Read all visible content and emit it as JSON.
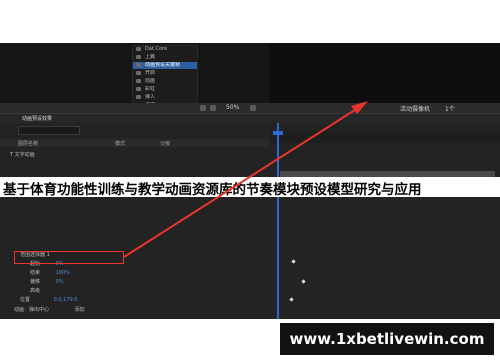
{
  "menu": {
    "items": [
      {
        "label": "Dat.Core"
      },
      {
        "label": "上翼"
      },
      {
        "label": "动画预设关键帧",
        "selected": true
      },
      {
        "label": "开启"
      },
      {
        "label": "动画"
      },
      {
        "label": "彩虹"
      },
      {
        "label": "弹入"
      },
      {
        "label": "弹跳"
      },
      {
        "label": "弹簧"
      }
    ]
  },
  "status": {
    "zoom": "50%",
    "view": "活动摄像机",
    "views": "1个"
  },
  "comp_tab": {
    "label": "动画预设效果"
  },
  "columns": {
    "layer_name": "图层名称",
    "parent": "父级",
    "mode": "模式"
  },
  "timeline_rows": [
    {
      "label": "T 文字动画"
    },
    {
      "label": "范围选择器 1"
    },
    {
      "label": "起始",
      "value": "0%"
    },
    {
      "label": "结束",
      "value": "100%"
    },
    {
      "label": "偏移",
      "value": "0%"
    },
    {
      "label": "高级"
    },
    {
      "label": "位置",
      "value": "0.0,179.0"
    },
    {
      "label": "动画：弹出中心",
      "extra": "添加"
    },
    {
      "label": "选择器：位移"
    },
    {
      "label": "摆动选择器：随机"
    },
    {
      "label": "位置",
      "value": "0.0,183.0"
    },
    {
      "label": "动画：比例（弹性）",
      "extra": "添加"
    }
  ],
  "banner": {
    "title": "基于体育功能性训练与教学动画资源库的节奏模块预设模型研究与应用"
  },
  "watermark": {
    "url": "www.1xbetlivewin.com"
  },
  "colors": {
    "arrow": "#e8352d",
    "timeline_cursor": "#2b6ad6",
    "value_blue": "#4d8fe0"
  }
}
